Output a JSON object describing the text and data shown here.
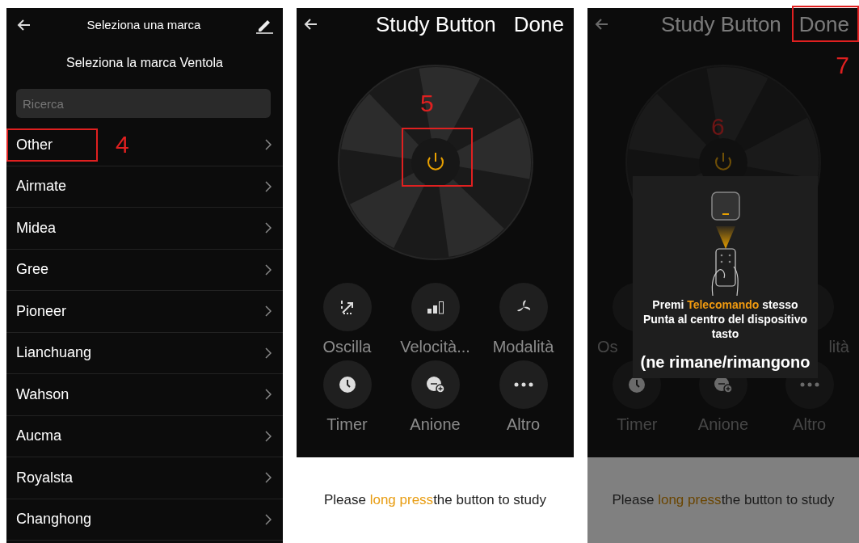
{
  "brand_screen": {
    "title": "Seleziona una marca",
    "subtitle": "Seleziona la marca Ventola",
    "search": {
      "placeholder": "Ricerca"
    },
    "brands": [
      {
        "label": "Other",
        "marked": true,
        "annotation": "4"
      },
      {
        "label": "Airmate",
        "marked": false
      },
      {
        "label": "Midea",
        "marked": false
      },
      {
        "label": "Gree",
        "marked": false
      },
      {
        "label": "Pioneer",
        "marked": false
      },
      {
        "label": "Lianchuang",
        "marked": false
      },
      {
        "label": "Wahson",
        "marked": false
      },
      {
        "label": "Aucma",
        "marked": false
      },
      {
        "label": "Royalsta",
        "marked": false
      },
      {
        "label": "Changhong",
        "marked": false
      }
    ]
  },
  "study_screens": [
    {
      "title": "Study Button",
      "done": "Done",
      "done_marked": false,
      "power_marked": true,
      "power_annotation": "5",
      "dimmed": false,
      "controls": [
        {
          "label": "Oscilla",
          "kind": "oscillate"
        },
        {
          "label": "Velocità...",
          "kind": "speed"
        },
        {
          "label": "Modalità",
          "kind": "mode"
        },
        {
          "label": "Timer",
          "kind": "timer"
        },
        {
          "label": "Anione",
          "kind": "anion"
        },
        {
          "label": "Altro",
          "kind": "more"
        }
      ],
      "hint": "Please **long press**the button to study"
    },
    {
      "title": "Study Button",
      "done": "Done",
      "done_marked": true,
      "done_annotation": "7",
      "power_marked": false,
      "power_annotation": "6",
      "dimmed": true,
      "controls": [
        {
          "label": "Os",
          "kind": "blank"
        },
        {
          "kind": "blank"
        },
        {
          "label": "lità",
          "kind": "blank"
        },
        {
          "label": "Timer",
          "kind": "timer"
        },
        {
          "label": "Anione",
          "kind": "anion"
        },
        {
          "label": "Altro",
          "kind": "more"
        }
      ],
      "dialog": {
        "lines": [
          "Premi **Telecomando** stesso",
          "Punta al centro del dispositivo tasto"
        ],
        "count": "(ne rimane/rimangono"
      },
      "hint": "Please **long press**the button to study"
    }
  ]
}
